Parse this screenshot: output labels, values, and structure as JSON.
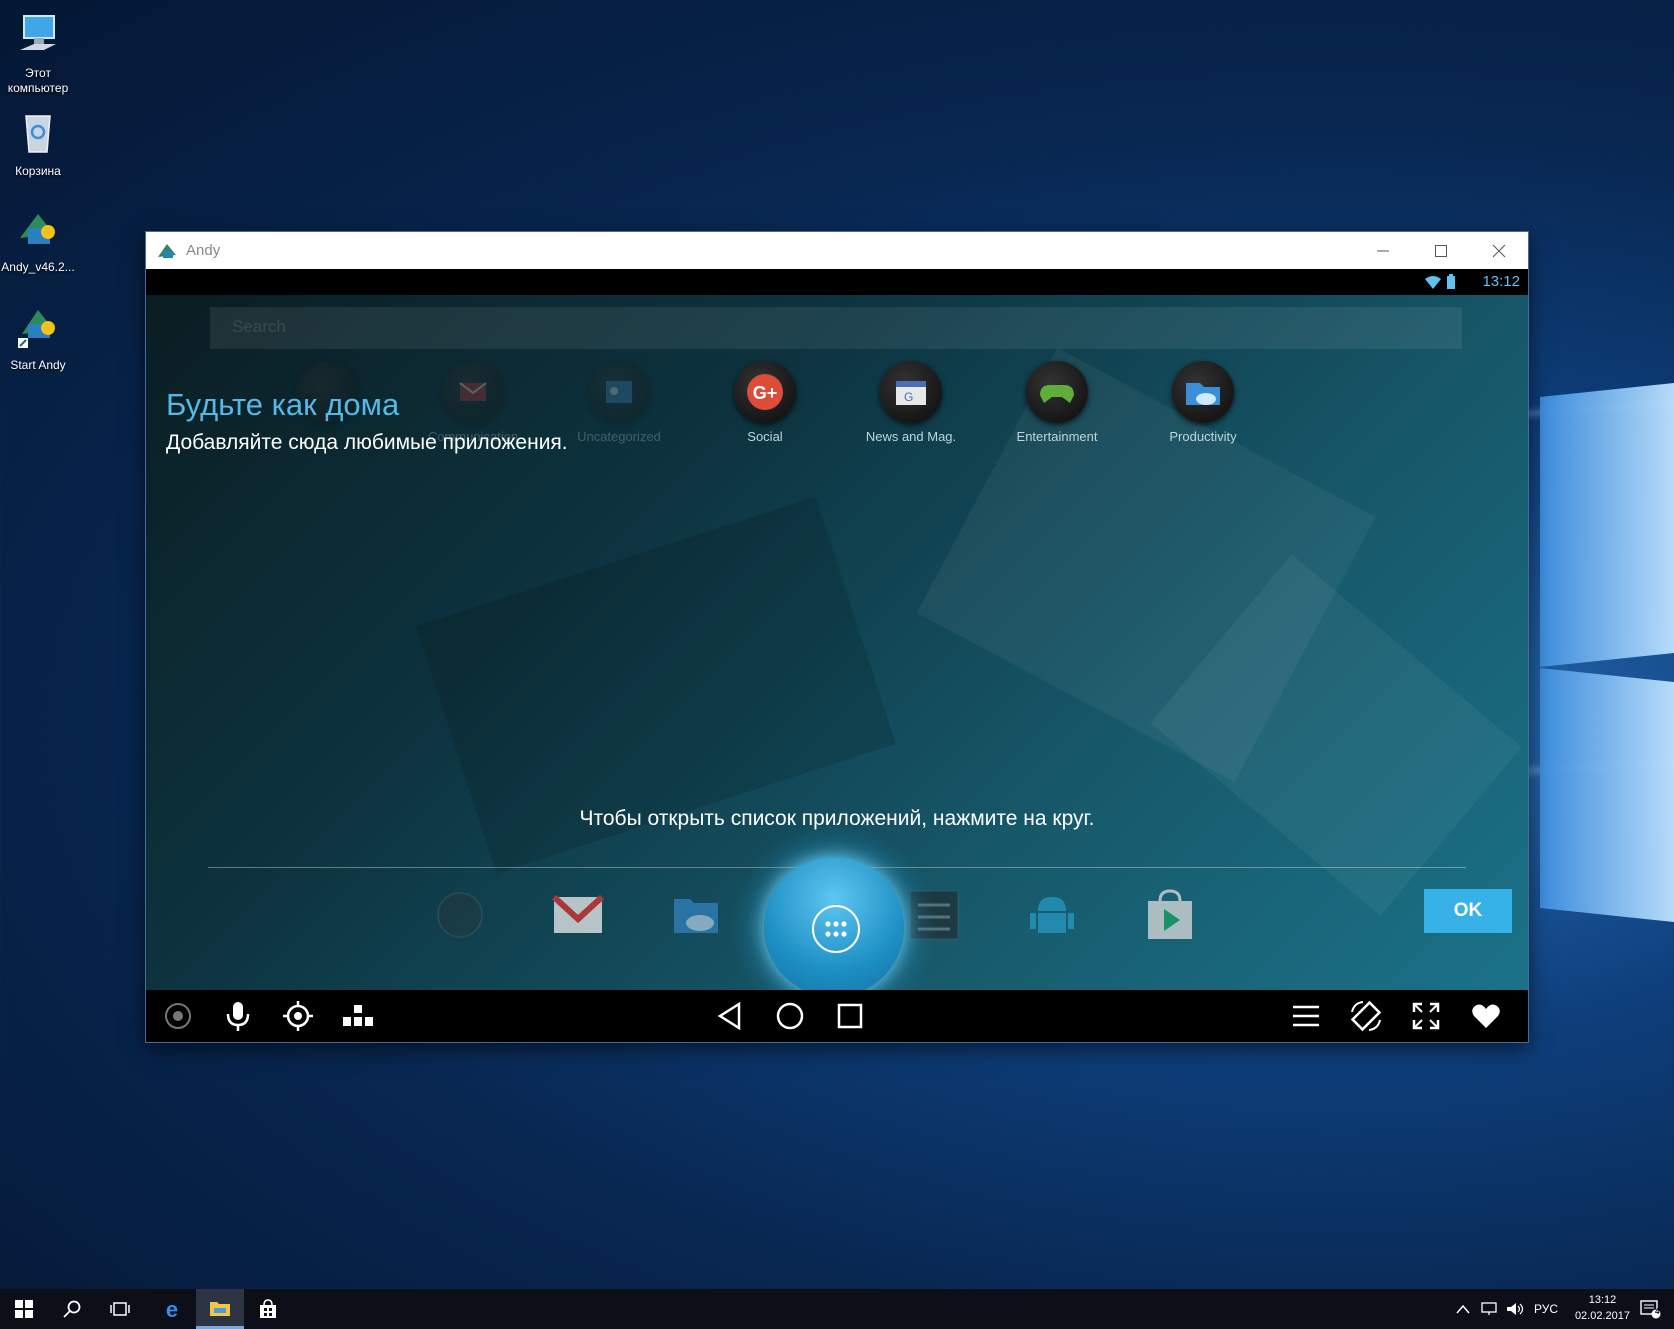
{
  "desktop": {
    "icons": [
      {
        "label_line1": "Этот",
        "label_line2": "компьютер"
      },
      {
        "label_line1": "Корзина",
        "label_line2": ""
      },
      {
        "label_line1": "Andy_v46.2...",
        "label_line2": ""
      },
      {
        "label_line1": "Start Andy",
        "label_line2": ""
      }
    ]
  },
  "window": {
    "title": "Andy",
    "status_time": "13:12"
  },
  "android": {
    "search_placeholder": "Search",
    "folders": [
      {
        "label": "",
        "icon": "folder-dark-icon"
      },
      {
        "label": "Communication",
        "icon": "mail-folder-icon"
      },
      {
        "label": "Uncategorized",
        "icon": "uncategorized-folder-icon"
      },
      {
        "label": "Social",
        "icon": "google-plus-icon"
      },
      {
        "label": "News and Mag.",
        "icon": "news-icon"
      },
      {
        "label": "Entertainment",
        "icon": "gamepad-icon"
      },
      {
        "label": "Productivity",
        "icon": "es-file-icon"
      }
    ],
    "hint_title": "Будьте как дома",
    "hint_subtitle": "Добавляйте сюда любимые приложения.",
    "hint_center": "Чтобы открыть список приложений, нажмите на круг.",
    "ok_label": "OK",
    "dock_apps": [
      "globe-icon",
      "gmail-icon",
      "es-explorer-icon",
      "settings-icon",
      "android-icon",
      "play-store-icon"
    ]
  },
  "taskbar": {
    "tray_lang": "РУС",
    "time": "13:12",
    "date": "02.02.2017",
    "notification_count": "4"
  },
  "colors": {
    "accent": "#36b2e8",
    "hint_title": "#56b8e6"
  }
}
